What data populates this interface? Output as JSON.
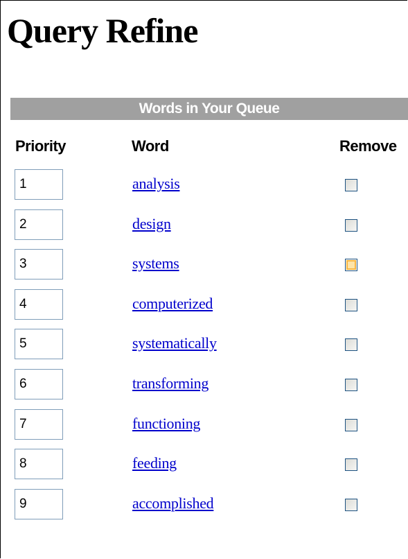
{
  "page": {
    "title": "Query Refine"
  },
  "queue": {
    "header": "Words in Your Queue",
    "columns": {
      "priority": "Priority",
      "word": "Word",
      "remove": "Remove"
    },
    "rows": [
      {
        "priority": "1",
        "word": "analysis",
        "remove_checked": false,
        "hovered": false
      },
      {
        "priority": "2",
        "word": "design",
        "remove_checked": false,
        "hovered": false
      },
      {
        "priority": "3",
        "word": "systems",
        "remove_checked": false,
        "hovered": true
      },
      {
        "priority": "4",
        "word": "computerized",
        "remove_checked": false,
        "hovered": false
      },
      {
        "priority": "5",
        "word": "systematically",
        "remove_checked": false,
        "hovered": false
      },
      {
        "priority": "6",
        "word": "transforming",
        "remove_checked": false,
        "hovered": false
      },
      {
        "priority": "7",
        "word": "functioning",
        "remove_checked": false,
        "hovered": false
      },
      {
        "priority": "8",
        "word": "feeding",
        "remove_checked": false,
        "hovered": false
      },
      {
        "priority": "9",
        "word": "accomplished",
        "remove_checked": false,
        "hovered": false
      }
    ]
  },
  "colors": {
    "header_bg": "#a0a0a0",
    "link": "#0000cc",
    "checkbox_hover": "#f7b440"
  }
}
